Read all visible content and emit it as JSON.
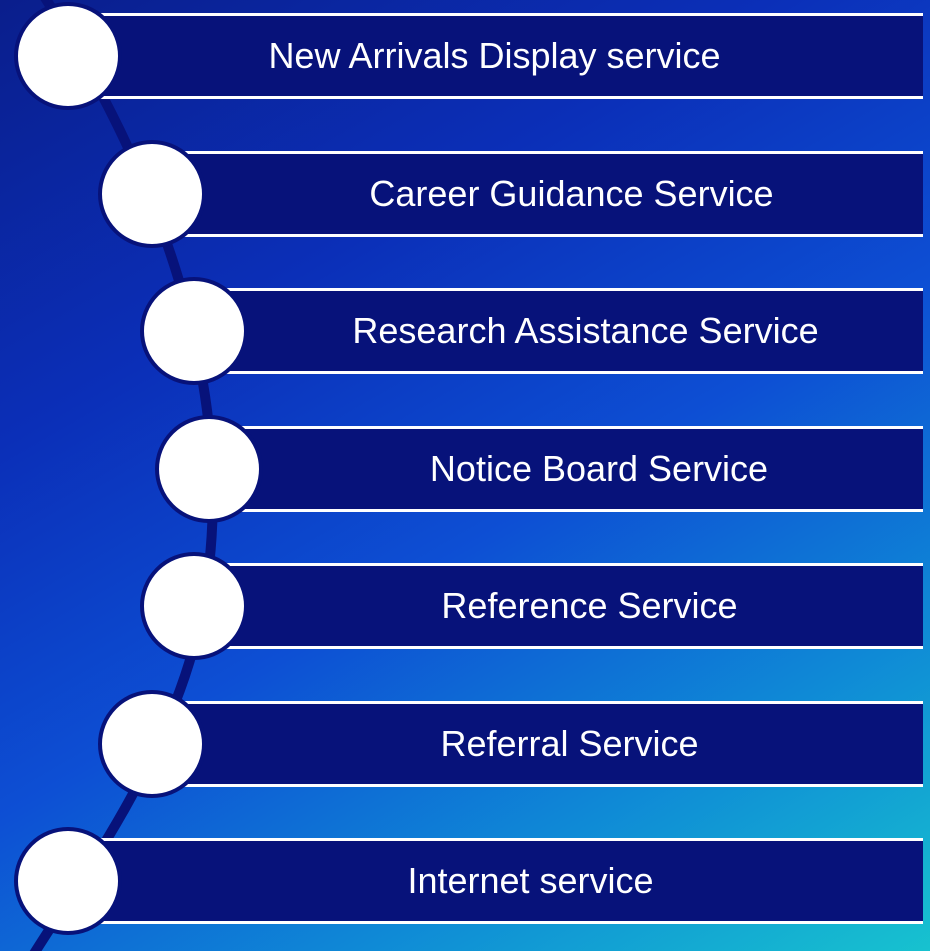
{
  "colors": {
    "bar_fill": "#07127a",
    "bar_border": "#ffffff",
    "circle_fill": "#ffffff",
    "text": "#ffffff"
  },
  "items": [
    {
      "label": "New Arrivals Display service"
    },
    {
      "label": "Career Guidance Service"
    },
    {
      "label": "Research Assistance Service"
    },
    {
      "label": "Notice Board Service"
    },
    {
      "label": "Reference Service"
    },
    {
      "label": "Referral Service"
    },
    {
      "label": "Internet service"
    }
  ]
}
